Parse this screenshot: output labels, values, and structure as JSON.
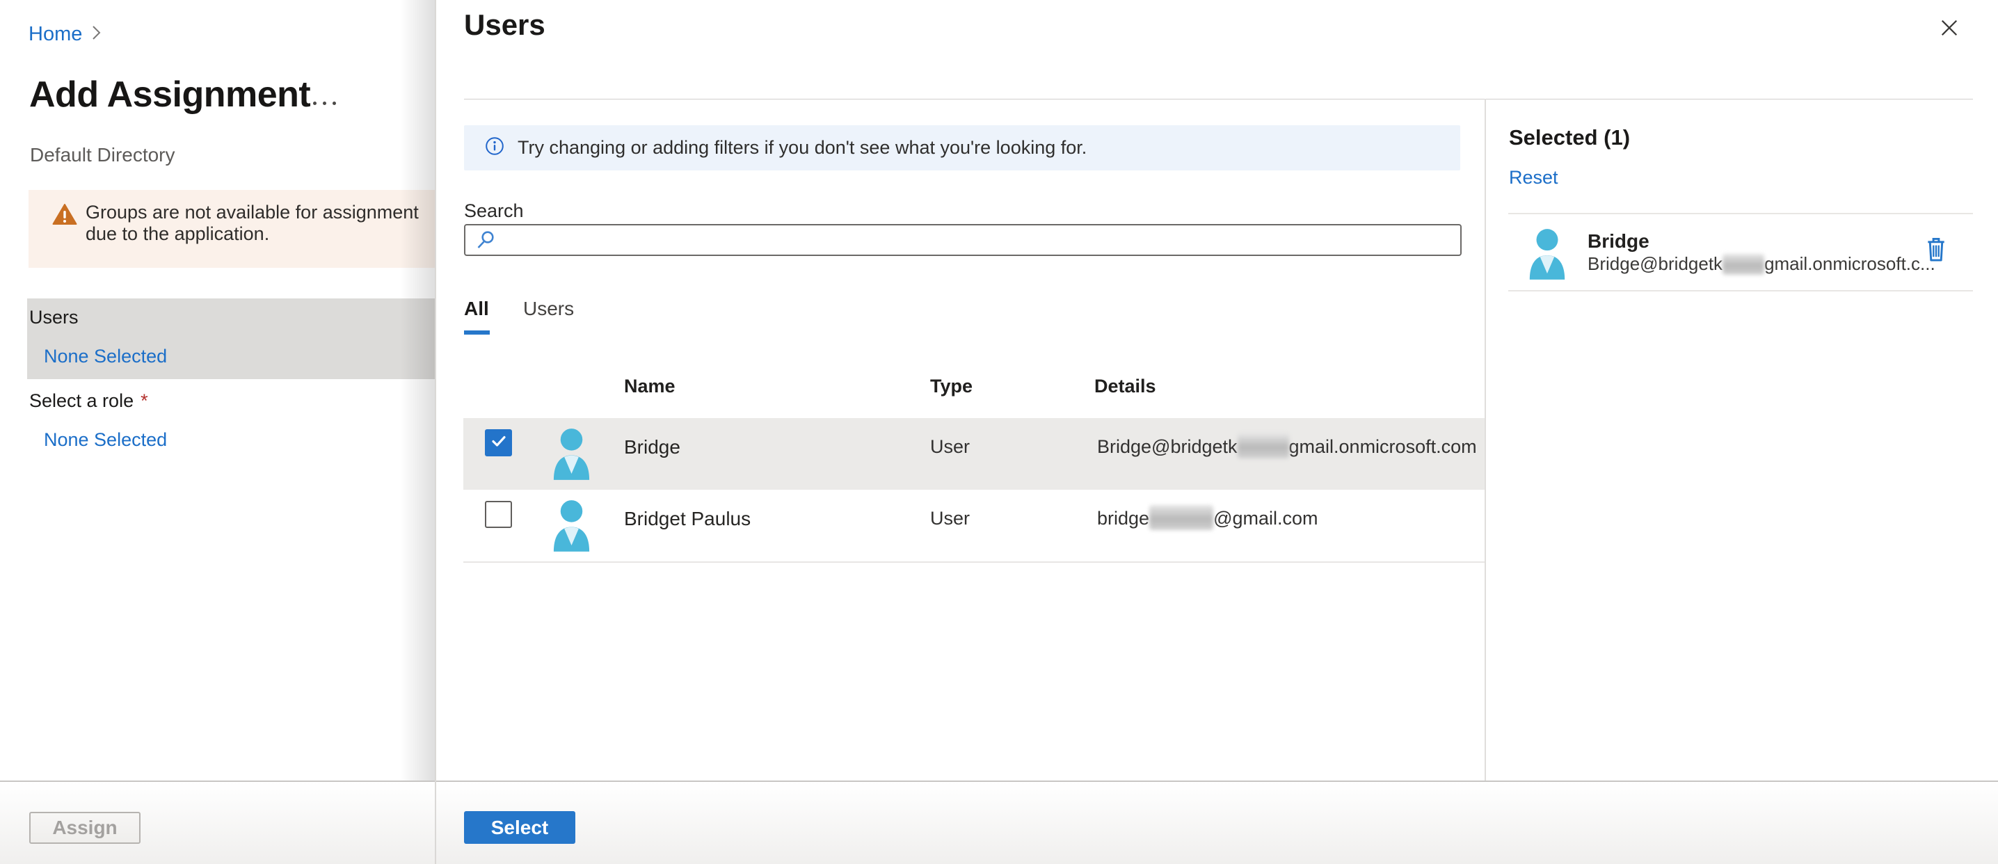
{
  "left_pane": {
    "breadcrumb": {
      "home": "Home"
    },
    "title": "Add Assignment",
    "subtitle": "Default Directory",
    "warning": {
      "text": "Groups are not available for assignment due to the application."
    },
    "menu": {
      "users_label": "Users",
      "users_value": "None Selected",
      "role_label": "Select a role",
      "role_required_mark": "*",
      "role_value": "None Selected"
    },
    "assign_button": "Assign"
  },
  "panel": {
    "title": "Users",
    "info_banner": "Try changing or adding filters if you don't see what you're looking for.",
    "search": {
      "label": "Search",
      "value": "",
      "placeholder": ""
    },
    "tabs": {
      "all": "All",
      "users": "Users"
    },
    "table": {
      "columns": [
        "Name",
        "Type",
        "Details"
      ],
      "rows": [
        {
          "name": "Bridge",
          "type": "User",
          "checked": true,
          "details_prefix": "Bridge@bridgetk",
          "details_suffix": "gmail.onmicrosoft.com"
        },
        {
          "name": "Bridget Paulus",
          "type": "User",
          "checked": false,
          "details_prefix": "bridge",
          "details_suffix": "@gmail.com"
        }
      ]
    },
    "selected_summary": {
      "heading": "Selected (1)",
      "reset": "Reset",
      "item": {
        "name": "Bridge",
        "email_prefix": "Bridge@bridgetk",
        "email_suffix": "gmail.onmicrosoft.c..."
      }
    },
    "select_button": "Select"
  },
  "icons": {
    "breadcrumb_separator": "chevron-right",
    "more_options": "ellipsis-horizontal",
    "warning": "warning-triangle",
    "info": "info-circle",
    "search": "magnifier",
    "checkbox_checked": "checkmark",
    "user": "person-silhouette",
    "delete": "trash-can",
    "close": "x-cross"
  },
  "colors": {
    "accent": "#2677ca",
    "link": "#1b6ec8",
    "warning_bg": "#fbf1ea",
    "warning_icon": "#c96f22",
    "selected_row_bg": "#ebeae8",
    "selected_menu_bg": "#dcdbd9",
    "info_bg": "#edf3fb",
    "avatar_blue": "#49b7da"
  }
}
